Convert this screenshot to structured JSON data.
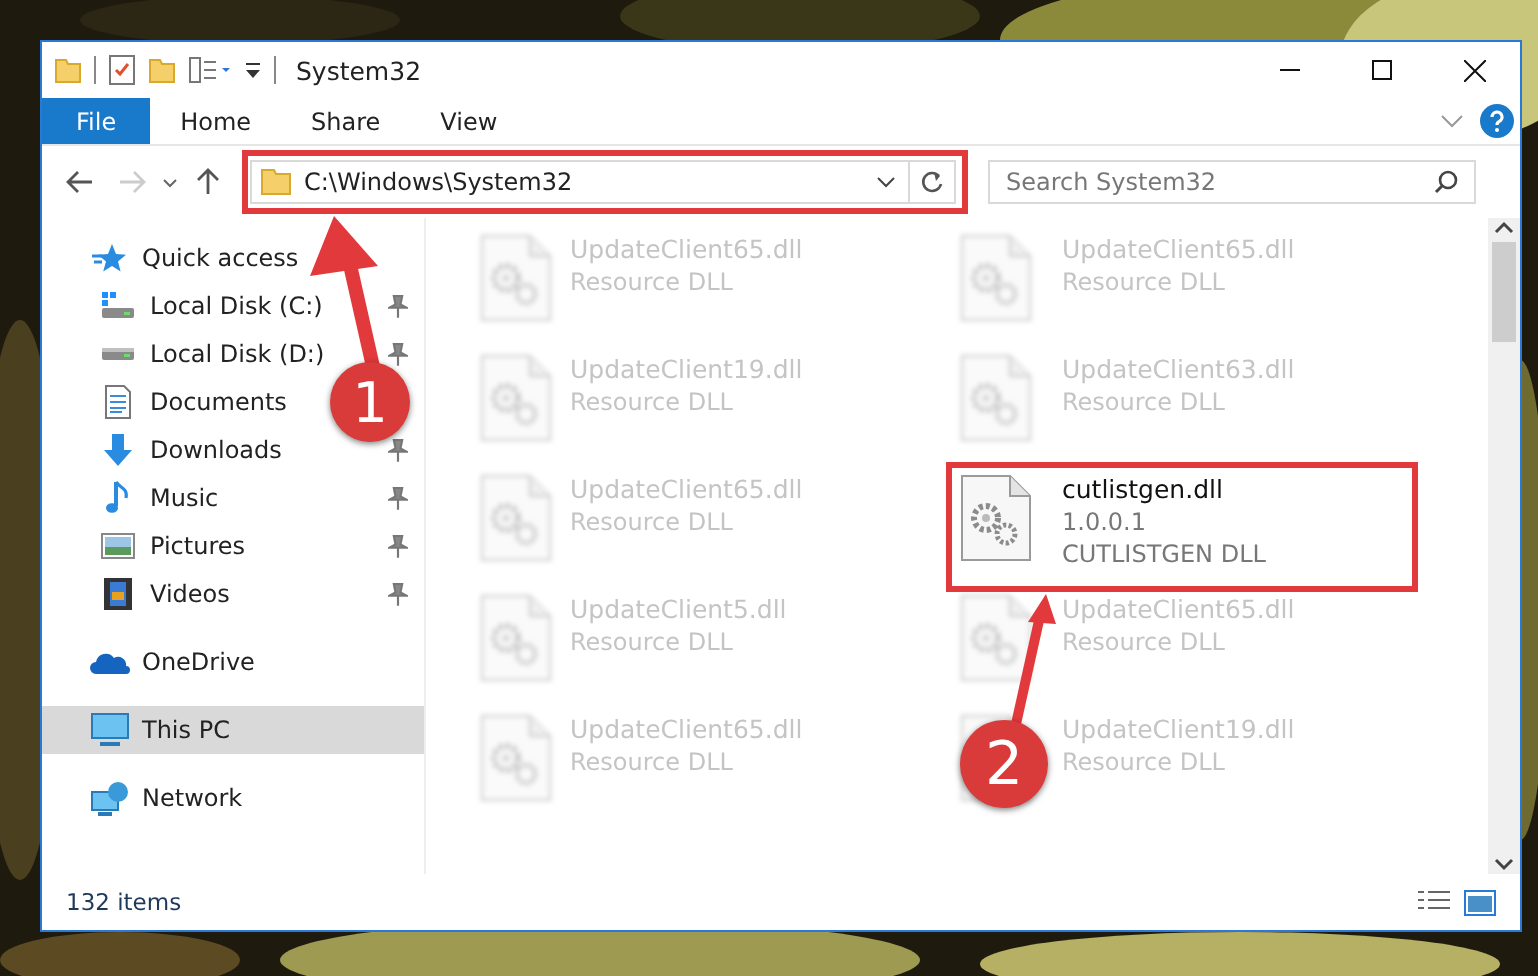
{
  "window": {
    "title": "System32"
  },
  "ribbon": {
    "tabs": [
      {
        "label": "File",
        "kind": "menu",
        "selected": false
      },
      {
        "label": "Home",
        "kind": "tab",
        "selected": false
      },
      {
        "label": "Share",
        "kind": "tab",
        "selected": false
      },
      {
        "label": "View",
        "kind": "tab",
        "selected": false
      }
    ]
  },
  "address_bar": {
    "path": "C:\\Windows\\System32"
  },
  "search": {
    "placeholder": "Search System32"
  },
  "sidebar": {
    "items": [
      {
        "label": "Quick access",
        "kind": "quick-access",
        "selected": false,
        "children": [
          {
            "label": "Local Disk (C:)",
            "kind": "system-drive",
            "pinned": true,
            "selected": false
          },
          {
            "label": "Local Disk (D:)",
            "kind": "drive",
            "pinned": true,
            "selected": false
          },
          {
            "label": "Documents",
            "kind": "documents",
            "pinned": false,
            "selected": false
          },
          {
            "label": "Downloads",
            "kind": "downloads",
            "pinned": true,
            "selected": false
          },
          {
            "label": "Music",
            "kind": "music",
            "pinned": true,
            "selected": false
          },
          {
            "label": "Pictures",
            "kind": "pictures",
            "pinned": true,
            "selected": false
          },
          {
            "label": "Videos",
            "kind": "videos",
            "pinned": true,
            "selected": false
          }
        ]
      },
      {
        "label": "OneDrive",
        "kind": "cloud",
        "selected": false
      },
      {
        "label": "This PC",
        "kind": "computer",
        "selected": true
      },
      {
        "label": "Network",
        "kind": "network",
        "selected": false
      }
    ]
  },
  "files": [
    {
      "name": "UpdateClient65.dll",
      "details": [
        "Resource DLL"
      ],
      "blurred": true
    },
    {
      "name": "UpdateClient65.dll",
      "details": [
        "Resource DLL"
      ],
      "blurred": true
    },
    {
      "name": "UpdateClient19.dll",
      "details": [
        "Resource DLL"
      ],
      "blurred": true
    },
    {
      "name": "UpdateClient63.dll",
      "details": [
        "Resource DLL"
      ],
      "blurred": true
    },
    {
      "name": "UpdateClient65.dll",
      "details": [
        "Resource DLL"
      ],
      "blurred": true
    },
    {
      "name": "cutlistgen.dll",
      "details": [
        "1.0.0.1",
        "CUTLISTGEN DLL"
      ],
      "blurred": false
    },
    {
      "name": "UpdateClient5.dll",
      "details": [
        "Resource DLL"
      ],
      "blurred": true
    },
    {
      "name": "UpdateClient65.dll",
      "details": [
        "Resource DLL"
      ],
      "blurred": true
    },
    {
      "name": "UpdateClient65.dll",
      "details": [
        "Resource DLL"
      ],
      "blurred": true
    },
    {
      "name": "UpdateClient19.dll",
      "details": [
        "Resource DLL"
      ],
      "blurred": true
    }
  ],
  "status_bar": {
    "item_count": "132 items"
  },
  "annotations": [
    {
      "number": "1"
    },
    {
      "number": "2"
    }
  ]
}
